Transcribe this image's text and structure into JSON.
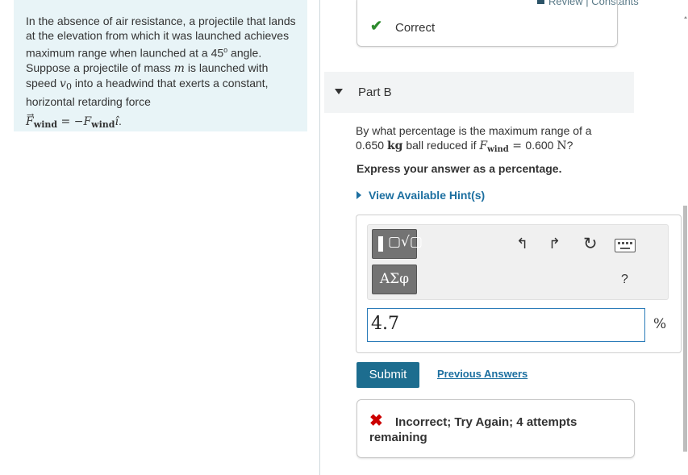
{
  "header": {
    "review_label": "Review",
    "sep": "|",
    "constants_label": "Constants"
  },
  "problem": {
    "text1": "In the absence of air resistance, a projectile that lands at the elevation from which it was launched achieves maximum range when launched at a 45",
    "degree": "o",
    "text2": " angle. Suppose a projectile of mass ",
    "mass_var": "m",
    "text3": " is launched with speed ",
    "speed_var": "v",
    "speed_sub": "0",
    "text4": " into a headwind that exerts a constant, horizontal retarding force",
    "formula_F": "F",
    "formula_sub": "wind",
    "formula_eq": " = −",
    "formula_i": "î",
    "formula_end": "."
  },
  "part_a": {
    "status": "Correct"
  },
  "part_b": {
    "title": "Part B",
    "q_text1": "By what percentage is the maximum range of a ",
    "q_mass": "0.650",
    "q_kg": "kg",
    "q_text2": " ball reduced if ",
    "q_F": "F",
    "q_sub": "wind",
    "q_eq": " = ",
    "q_force": "0.600",
    "q_N": "N",
    "q_end": "?",
    "express": "Express your answer as a percentage.",
    "hint": "View Available Hint(s)"
  },
  "toolbar": {
    "templates_icon": "templates-icon",
    "symbols_label": "ΑΣφ",
    "undo_icon": "↰",
    "redo_icon": "↱",
    "reset_icon": "↻",
    "help_label": "?"
  },
  "answer": {
    "value": "4.7",
    "unit": "%"
  },
  "actions": {
    "submit": "Submit",
    "previous": "Previous Answers"
  },
  "feedback": {
    "message": "Incorrect; Try Again; 4 attempts remaining"
  },
  "colors": {
    "accent": "#1d6d8f",
    "link": "#1c6fa0",
    "correct": "#2e8b2e",
    "incorrect": "#cc0000",
    "problem_bg": "#e8f4f7"
  }
}
